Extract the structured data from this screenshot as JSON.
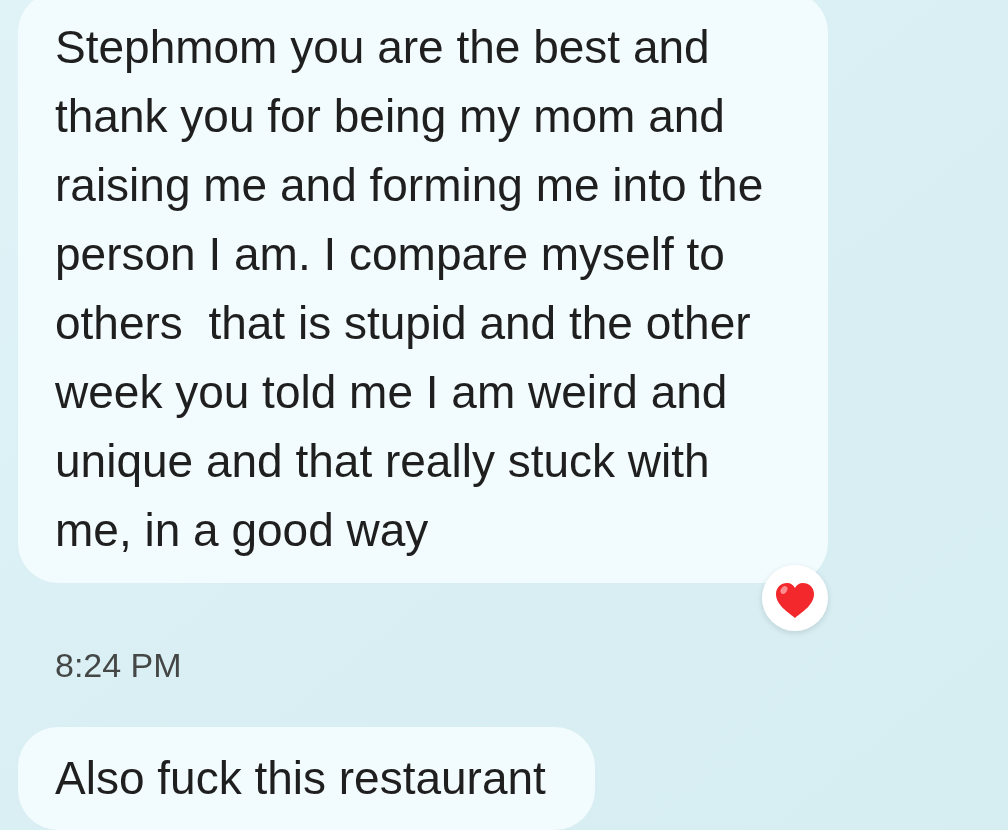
{
  "conversation": [
    {
      "kind": "message",
      "text": "Stephmom you are the best and thank you for being my mom and raising me and forming me into the person I am. I compare myself to others  that is stupid and the other week you told me I am weird and unique and that really stuck with me, in a good way",
      "reacted": true
    },
    {
      "kind": "timestamp",
      "text": "8:24 PM"
    },
    {
      "kind": "message",
      "text": "Also fuck this restaurant",
      "reacted": false
    }
  ]
}
